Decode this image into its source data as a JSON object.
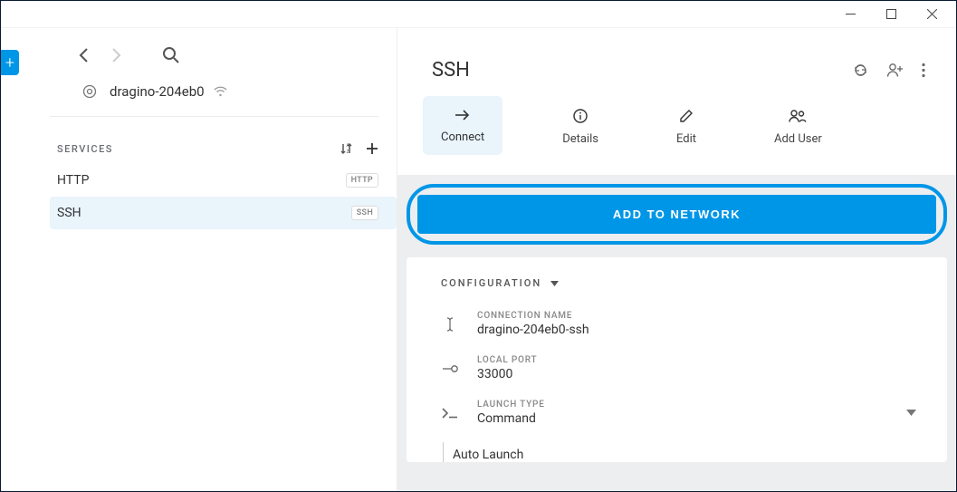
{
  "titlebar": {},
  "left_tab": {
    "label": "+"
  },
  "sidebar": {
    "device_name": "dragino-204eb0",
    "services_label": "SERVICES",
    "items": [
      {
        "name": "HTTP",
        "badge": "HTTP",
        "selected": false
      },
      {
        "name": "SSH",
        "badge": "SSH",
        "selected": true
      }
    ]
  },
  "main": {
    "title": "SSH",
    "actions": [
      {
        "label": "Connect",
        "active": true
      },
      {
        "label": "Details",
        "active": false
      },
      {
        "label": "Edit",
        "active": false
      },
      {
        "label": "Add User",
        "active": false
      }
    ],
    "add_network_label": "ADD TO NETWORK",
    "config": {
      "header": "CONFIGURATION",
      "connection_name_label": "CONNECTION NAME",
      "connection_name_value": "dragino-204eb0-ssh",
      "local_port_label": "LOCAL PORT",
      "local_port_value": "33000",
      "launch_type_label": "LAUNCH TYPE",
      "launch_type_value": "Command",
      "auto_launch_label": "Auto Launch"
    }
  }
}
